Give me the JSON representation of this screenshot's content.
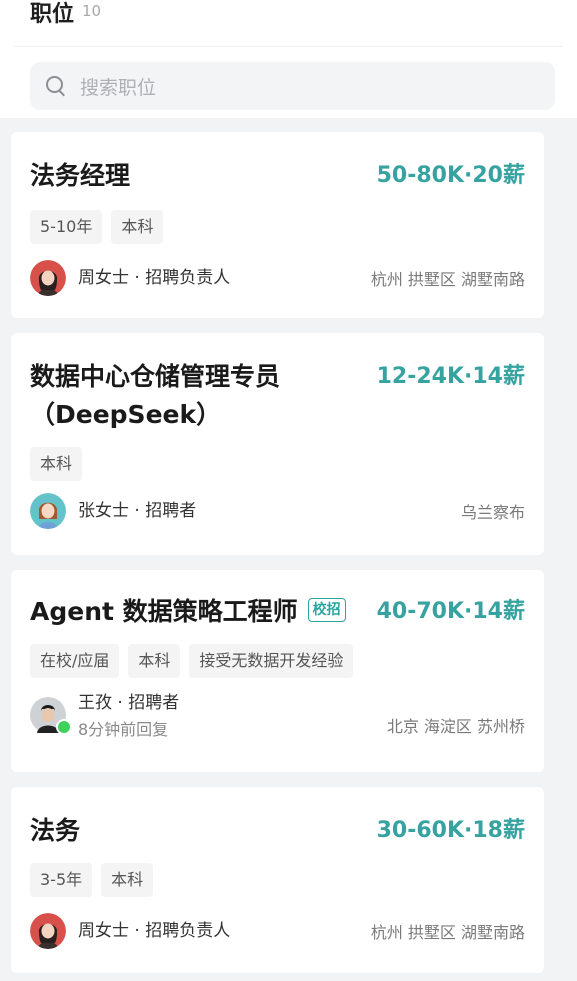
{
  "header": {
    "title": "职位",
    "count": "10"
  },
  "search": {
    "placeholder": "搜索职位"
  },
  "colors": {
    "salary": "#36a3a0",
    "accent": "#2aa69e",
    "online": "#3fd25a"
  },
  "jobs": [
    {
      "title": "法务经理",
      "salary": "50-80K·20薪",
      "tags": [
        "5-10年",
        "本科"
      ],
      "recruiter": "周女士 · 招聘负责人",
      "location": "杭州 拱墅区 湖墅南路",
      "avatar_icon": "woman-avatar-icon"
    },
    {
      "title_line1": "数据中心仓储管理专员",
      "title_line2": "（DeepSeek）",
      "salary": "12-24K·14薪",
      "tags": [
        "本科"
      ],
      "recruiter": "张女士 · 招聘者",
      "location": "乌兰察布",
      "avatar_icon": "cartoon-woman-avatar-icon"
    },
    {
      "title": "Agent 数据策略工程师",
      "badge": "校招",
      "salary": "40-70K·14薪",
      "tags": [
        "在校/应届",
        "本科",
        "接受无数据开发经验"
      ],
      "recruiter": "王孜 · 招聘者",
      "recruiter_status": "8分钟前回复",
      "location": "北京 海淀区 苏州桥",
      "avatar_icon": "man-avatar-icon"
    },
    {
      "title": "法务",
      "salary": "30-60K·18薪",
      "tags": [
        "3-5年",
        "本科"
      ],
      "recruiter": "周女士 · 招聘负责人",
      "location": "杭州 拱墅区 湖墅南路",
      "avatar_icon": "woman-avatar-icon"
    }
  ]
}
